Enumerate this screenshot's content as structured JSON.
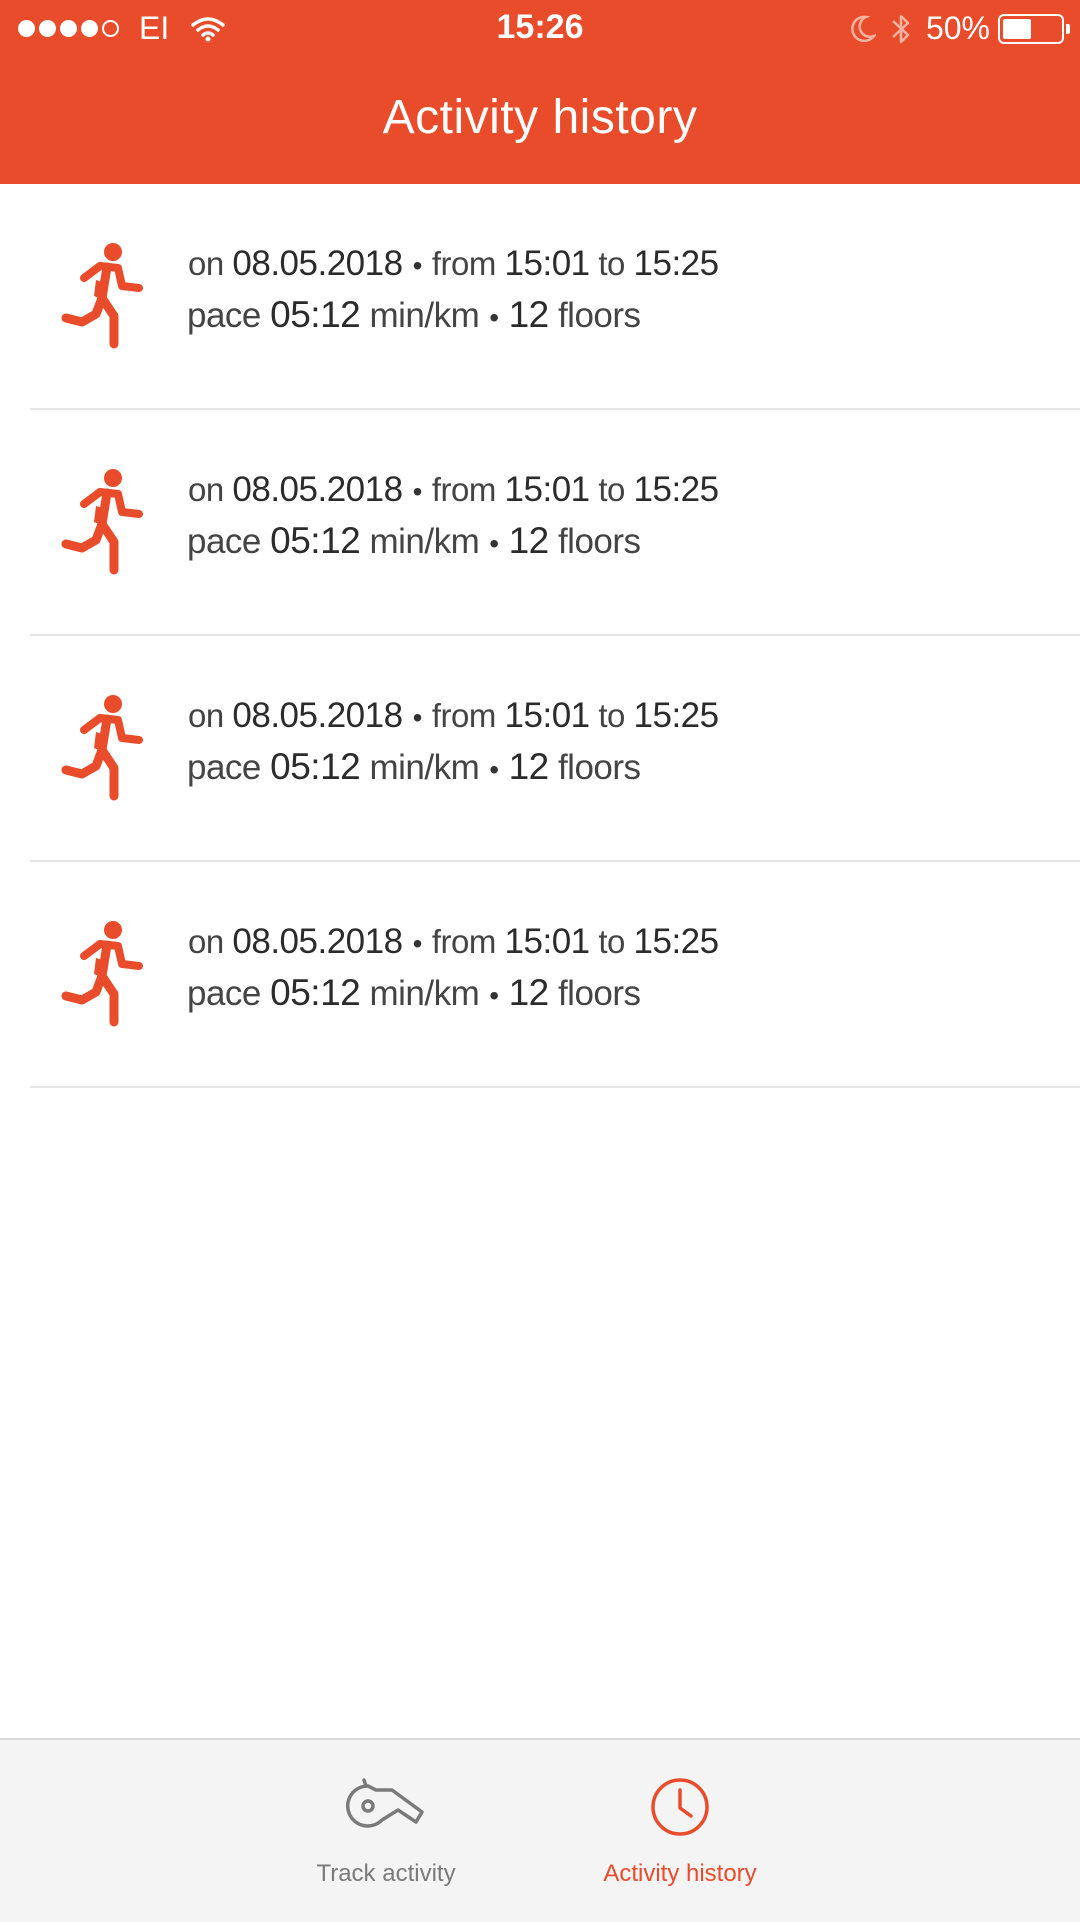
{
  "status_bar": {
    "carrier": "EI",
    "time": "15:26",
    "battery": "50%",
    "battery_level": 0.5,
    "signal_bars_filled": 4,
    "signal_bars_total": 5
  },
  "header": {
    "title": "Activity history",
    "background_color": "#E94C2B"
  },
  "activities": [
    {
      "icon": "runner-icon",
      "on_label": "on",
      "date": "08.05.2018",
      "from_label": "from",
      "start": "15:01",
      "to_label": "to",
      "end": "15:25",
      "pace_label": "pace",
      "pace": "05:12",
      "pace_unit": "min/km",
      "floors": "12",
      "floors_label": "floors"
    },
    {
      "icon": "runner-icon",
      "on_label": "on",
      "date": "08.05.2018",
      "from_label": "from",
      "start": "15:01",
      "to_label": "to",
      "end": "15:25",
      "pace_label": "pace",
      "pace": "05:12",
      "pace_unit": "min/km",
      "floors": "12",
      "floors_label": "floors"
    },
    {
      "icon": "runner-icon",
      "on_label": "on",
      "date": "08.05.2018",
      "from_label": "from",
      "start": "15:01",
      "to_label": "to",
      "end": "15:25",
      "pace_label": "pace",
      "pace": "05:12",
      "pace_unit": "min/km",
      "floors": "12",
      "floors_label": "floors"
    },
    {
      "icon": "runner-icon",
      "on_label": "on",
      "date": "08.05.2018",
      "from_label": "from",
      "start": "15:01",
      "to_label": "to",
      "end": "15:25",
      "pace_label": "pace",
      "pace": "05:12",
      "pace_unit": "min/km",
      "floors": "12",
      "floors_label": "floors"
    }
  ],
  "tab_bar": {
    "tabs": [
      {
        "label": "Track activity",
        "icon": "whistle-icon",
        "active": false
      },
      {
        "label": "Activity history",
        "icon": "clock-icon",
        "active": true
      }
    ],
    "active_color": "#E94C2B",
    "inactive_color": "#7a7a7a"
  }
}
